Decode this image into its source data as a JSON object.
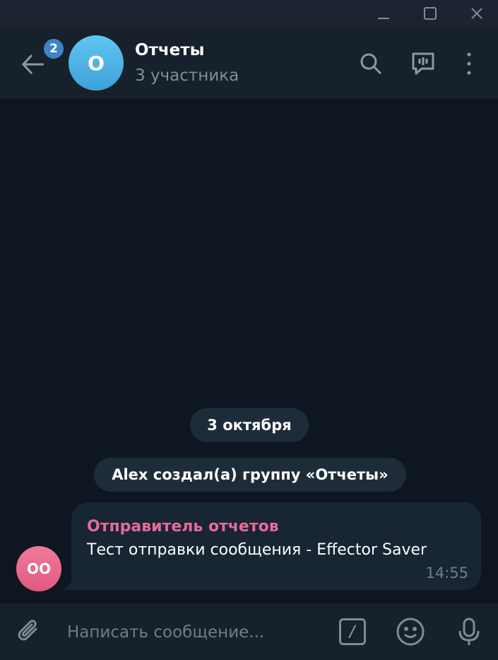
{
  "window": {
    "minimize_icon": "minimize-icon",
    "maximize_icon": "maximize-icon",
    "close_icon": "close-icon"
  },
  "header": {
    "unread_count": "2",
    "avatar_letter": "О",
    "title": "Отчеты",
    "subtitle": "3 участника"
  },
  "messages": {
    "date": "3 октября",
    "service": "Alex создал(а) группу «Отчеты»",
    "items": [
      {
        "avatar_initials": "ОО",
        "sender": "Отправитель отчетов",
        "text": "Тест отправки сообщения - Effector Saver",
        "time": "14:55"
      }
    ]
  },
  "composer": {
    "placeholder": "Написать сообщение...",
    "command_label": "/"
  },
  "colors": {
    "background": "#0e1621",
    "header": "#17212b",
    "sender_name": "#e56a9a",
    "avatar_group": "#3ea0d9",
    "avatar_user": "#e0597f",
    "unread_badge": "#3e84c6"
  }
}
